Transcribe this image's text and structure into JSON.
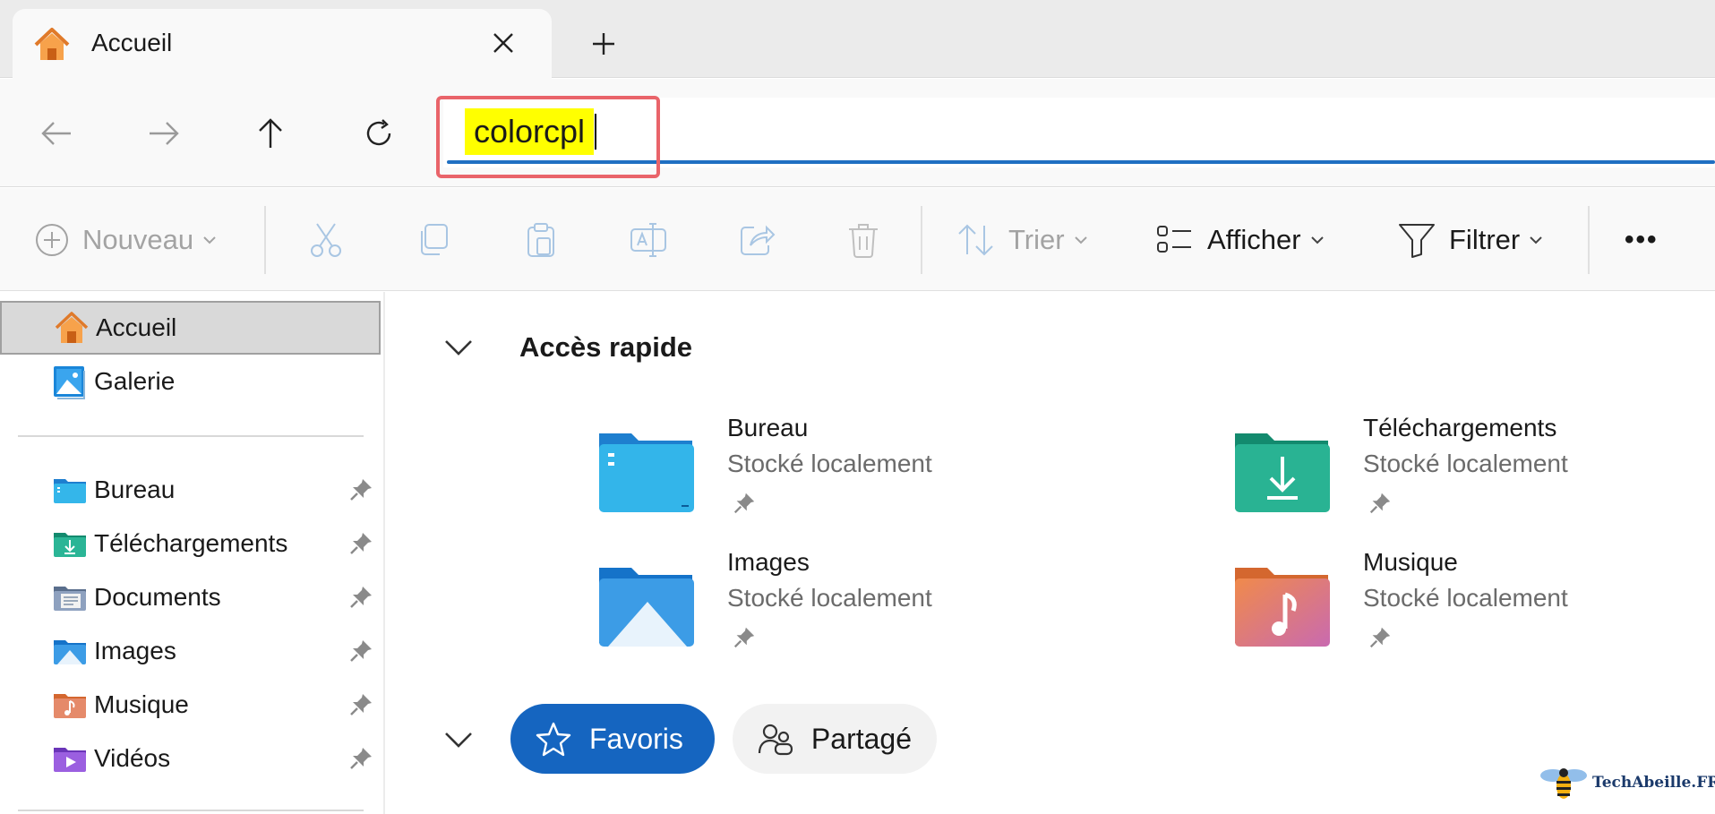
{
  "tab": {
    "title": "Accueil",
    "close_icon": "close-icon",
    "new_tab_icon": "plus-icon"
  },
  "nav": {
    "back_icon": "arrow-left-icon",
    "forward_icon": "arrow-right-icon",
    "up_icon": "arrow-up-icon",
    "refresh_icon": "refresh-icon"
  },
  "address": {
    "value": "colorcpl",
    "highlight_color": "#e9646a",
    "selection_color": "#ffff00"
  },
  "toolbar": {
    "new_label": "Nouveau",
    "sort_label": "Trier",
    "view_label": "Afficher",
    "filter_label": "Filtrer",
    "more_label": "•••"
  },
  "sidebar": {
    "top_items": [
      {
        "label": "Accueil",
        "icon": "home-icon",
        "active": true
      },
      {
        "label": "Galerie",
        "icon": "gallery-icon"
      }
    ],
    "pinned_items": [
      {
        "label": "Bureau",
        "icon": "desktop-folder-icon"
      },
      {
        "label": "Téléchargements",
        "icon": "downloads-folder-icon"
      },
      {
        "label": "Documents",
        "icon": "documents-folder-icon"
      },
      {
        "label": "Images",
        "icon": "pictures-folder-icon"
      },
      {
        "label": "Musique",
        "icon": "music-folder-icon"
      },
      {
        "label": "Vidéos",
        "icon": "videos-folder-icon"
      }
    ]
  },
  "main": {
    "quick_access_title": "Accès rapide",
    "quick_access": [
      {
        "name": "Bureau",
        "sub": "Stocké localement",
        "icon": "desktop-folder-icon"
      },
      {
        "name": "Téléchargements",
        "sub": "Stocké localement",
        "icon": "downloads-folder-icon"
      },
      {
        "name": "Images",
        "sub": "Stocké localement",
        "icon": "pictures-folder-icon"
      },
      {
        "name": "Musique",
        "sub": "Stocké localement",
        "icon": "music-folder-icon"
      }
    ],
    "favorites_label": "Favoris",
    "shared_label": "Partagé"
  },
  "watermark": {
    "text": "TechAbeille.FR"
  },
  "colors": {
    "accent": "#1565c0",
    "underline": "#1f6fc2"
  }
}
